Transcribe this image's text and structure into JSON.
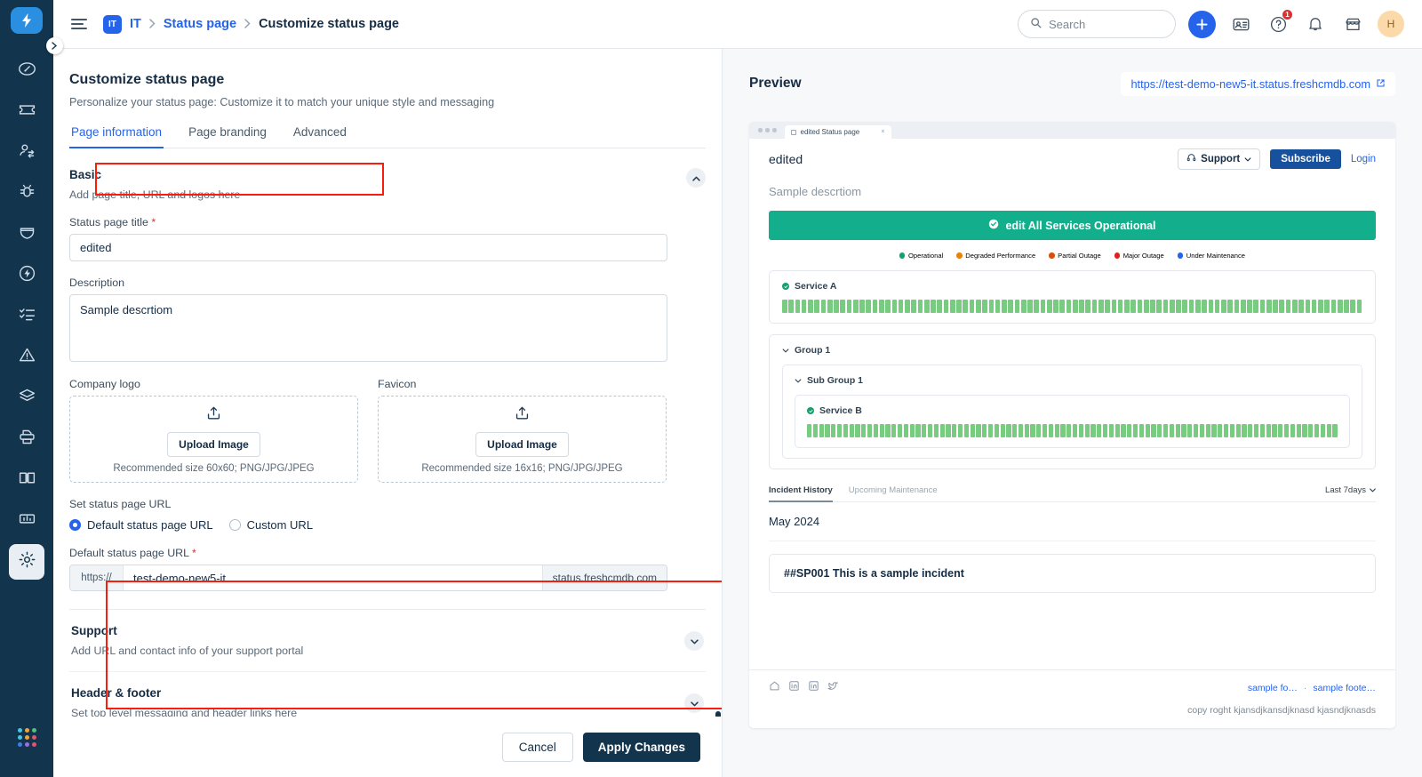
{
  "sidebar": {
    "logo_icon": "lightning-logo",
    "expand_icon": "chevron-right-icon",
    "items": [
      {
        "name": "dashboard",
        "icon": "gauge-icon",
        "has_menu": false
      },
      {
        "name": "tickets",
        "icon": "ticket-icon",
        "has_menu": true
      },
      {
        "name": "contacts",
        "icon": "contacts-switch-icon",
        "has_menu": true
      },
      {
        "name": "problems",
        "icon": "bug-icon",
        "has_menu": false
      },
      {
        "name": "changes",
        "icon": "shield-icon",
        "has_menu": false
      },
      {
        "name": "releases",
        "icon": "flash-circle-icon",
        "has_menu": false
      },
      {
        "name": "tasks",
        "icon": "checklist-icon",
        "has_menu": false
      },
      {
        "name": "alerts",
        "icon": "alert-triangle-icon",
        "has_menu": true
      },
      {
        "name": "assets",
        "icon": "layers-icon",
        "has_menu": true
      },
      {
        "name": "inventory",
        "icon": "printer-icon",
        "has_menu": true
      },
      {
        "name": "solutions",
        "icon": "book-icon",
        "has_menu": false
      },
      {
        "name": "analytics",
        "icon": "bar-chart-icon",
        "has_menu": true
      },
      {
        "name": "admin",
        "icon": "gear-icon",
        "has_menu": false,
        "active": true
      }
    ],
    "app_switcher_icon": "grid-dots-icon",
    "app_switcher_colors": [
      "#4ac4e8",
      "#f0a43a",
      "#55c07b",
      "#4ac4e8",
      "#f0a43a",
      "#e05570",
      "#3f7fe0",
      "#9a6ee0",
      "#e05570"
    ]
  },
  "topbar": {
    "menu_icon": "hamburger-icon",
    "workspace_badge": "IT",
    "workspace_label": "IT",
    "breadcrumb_link": "Status page",
    "breadcrumb_current": "Customize status page",
    "separator": "›",
    "search_placeholder": "Search",
    "search_icon": "search-icon",
    "add_icon": "plus-icon",
    "contact_card_icon": "contact-card-icon",
    "help_icon": "help-circle-icon",
    "help_badge": "1",
    "bell_icon": "bell-icon",
    "marketplace_icon": "marketplace-icon",
    "avatar_initial": "H"
  },
  "editor": {
    "title": "Customize status page",
    "subtitle": "Personalize your status page: Customize it to match your unique style and messaging",
    "tabs": [
      {
        "label": "Page information",
        "active": true
      },
      {
        "label": "Page branding",
        "active": false
      },
      {
        "label": "Advanced",
        "active": false
      }
    ],
    "basic": {
      "title": "Basic",
      "description": "Add page title, URL and logos here",
      "collapse_icon": "chevron-up-icon"
    },
    "status_page_title": {
      "label": "Status page title",
      "required": "*",
      "value": "edited"
    },
    "description": {
      "label": "Description",
      "value": "Sample descrtiom"
    },
    "company_logo": {
      "label": "Company logo",
      "upload_icon": "upload-icon",
      "button": "Upload Image",
      "hint": "Recommended size 60x60; PNG/JPG/JPEG"
    },
    "favicon": {
      "label": "Favicon",
      "upload_icon": "upload-icon",
      "button": "Upload Image",
      "hint": "Recommended size 16x16; PNG/JPG/JPEG"
    },
    "url_section": {
      "label": "Set status page URL",
      "options": [
        {
          "label": "Default status page URL",
          "selected": true
        },
        {
          "label": "Custom URL",
          "selected": false
        }
      ],
      "field_label": "Default status page URL",
      "required": "*",
      "prefix": "https://",
      "value": "test-demo-new5-it",
      "suffix": "status.freshcmdb.com"
    },
    "collapsed_sections": [
      {
        "title": "Support",
        "description": "Add URL and contact info of your support portal",
        "chevron": "chevron-down-icon"
      },
      {
        "title": "Header & footer",
        "description": "Set top level messaging and header links here",
        "chevron": "chevron-down-icon"
      }
    ],
    "footer": {
      "cancel": "Cancel",
      "apply": "Apply Changes"
    },
    "annotation_color": "#f81d0c"
  },
  "preview": {
    "title": "Preview",
    "url": "https://test-demo-new5-it.status.freshcmdb.com",
    "external_icon": "external-link-icon",
    "browser_tab": "edited Status page",
    "browser_tab_close": "×",
    "status_page": {
      "logo_text": "edited",
      "support_button": "Support",
      "support_icon": "headset-icon",
      "support_chevron": "chevron-down-icon",
      "subscribe_button": "Subscribe",
      "login_link": "Login",
      "description": "Sample descrtiom",
      "banner_text": "edit All Services Operational",
      "banner_icon": "check-circle-icon",
      "banner_color": "#13ae8b",
      "legend": [
        {
          "label": "Operational",
          "color": "#14a06f"
        },
        {
          "label": "Degraded Performance",
          "color": "#e8820c"
        },
        {
          "label": "Partial Outage",
          "color": "#d94f0a"
        },
        {
          "label": "Major Outage",
          "color": "#e02020"
        },
        {
          "label": "Under Maintenance",
          "color": "#2663eb"
        }
      ],
      "services": [
        {
          "name": "Service A",
          "status_icon": "check-circle-icon",
          "bar_color": "#77cc7f",
          "bar_count": 90
        }
      ],
      "group": {
        "name": "Group 1",
        "chevron": "chevron-down-icon",
        "sub_group": {
          "name": "Sub Group 1",
          "chevron": "chevron-down-icon",
          "services": [
            {
              "name": "Service B",
              "status_icon": "check-circle-icon",
              "bar_color": "#77cc7f",
              "bar_count": 88
            }
          ]
        }
      },
      "incident_tabs": [
        {
          "label": "Incident History",
          "active": true
        },
        {
          "label": "Upcoming Maintenance",
          "active": false
        }
      ],
      "range_label": "Last 7days",
      "range_chevron": "chevron-down-icon",
      "month": "May 2024",
      "incidents": [
        {
          "title": "##SP001 This is a sample incident"
        }
      ],
      "footer_icons": [
        "home-icon",
        "linkedin-icon",
        "linkedin-icon",
        "twitter-icon"
      ],
      "footer_links": [
        "sample fo…",
        "sample foote…"
      ],
      "footer_sep": "·",
      "copyright": "copy roght kjansdjkansdjknasd kjasndjknasds"
    }
  }
}
